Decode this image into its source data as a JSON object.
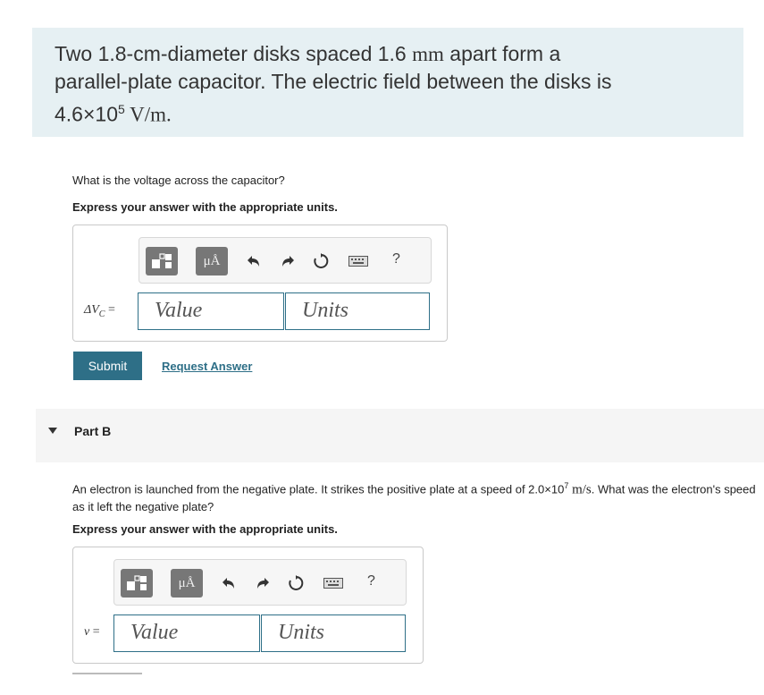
{
  "intro": {
    "line1": "Two 1.8-cm-diameter disks spaced 1.6 ",
    "line1_unit": "mm",
    "line1_end": " apart form a",
    "line2": "parallel-plate capacitor. The electric field between the disks is",
    "line3_base": "4.6×10",
    "line3_exp": "5",
    "line3_unit": " V/m."
  },
  "partA": {
    "question": "What is the voltage across the capacitor?",
    "instruction": "Express your answer with the appropriate units.",
    "toolbar": {
      "units_btn": "μÅ",
      "help": "?"
    },
    "label_var": "ΔV",
    "label_sub": "C",
    "label_eq": " =",
    "value_placeholder": "Value",
    "units_placeholder": "Units",
    "submit": "Submit",
    "request": "Request Answer"
  },
  "partB": {
    "title": "Part B",
    "question_part1": "An electron is launched from the negative plate. It strikes the positive plate at a speed of 2.0×10",
    "question_exp": "7",
    "question_unit": " m/s",
    "question_part2": ". What was the electron's speed as it left the negative plate?",
    "instruction": "Express your answer with the appropriate units.",
    "toolbar": {
      "units_btn": "μÅ",
      "help": "?"
    },
    "label_var": "v",
    "label_eq": " =",
    "value_placeholder": "Value",
    "units_placeholder": "Units"
  },
  "icons": [
    "templates-icon",
    "undo-icon",
    "redo-icon",
    "reset-icon",
    "keyboard-icon",
    "help-icon"
  ],
  "colors": {
    "accent": "#2e6f87",
    "intro_bg": "#e6f0f3"
  }
}
